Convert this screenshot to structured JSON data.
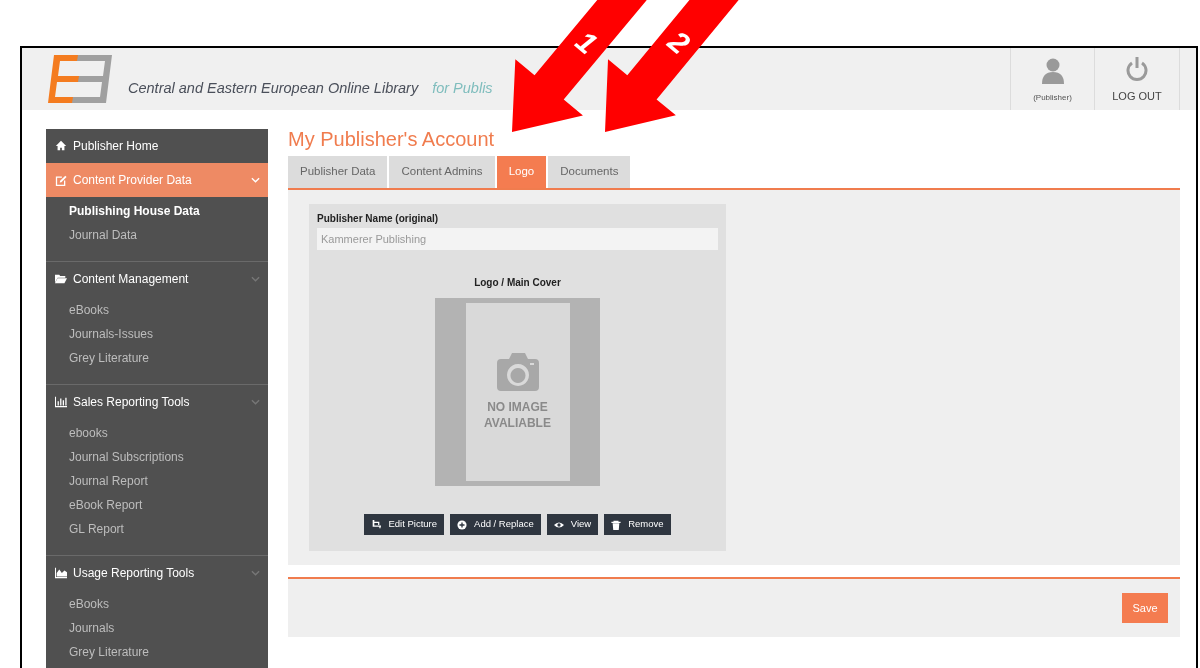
{
  "header": {
    "site_name": "Central and Eastern European Online Library",
    "tagline": "for Publis",
    "user_label": "(Publisher)",
    "logout_label": "LOG OUT"
  },
  "sidebar": {
    "sections": [
      {
        "label": "Publisher Home",
        "kind": "home",
        "selected": false
      },
      {
        "label": "Content Provider Data",
        "kind": "edit",
        "selected": true,
        "items": [
          {
            "label": "Publishing House Data",
            "selected": true
          },
          {
            "label": "Journal Data",
            "selected": false
          }
        ]
      },
      {
        "label": "Content Management",
        "kind": "folder",
        "selected": false,
        "items": [
          {
            "label": "eBooks",
            "selected": false
          },
          {
            "label": "Journals-Issues",
            "selected": false
          },
          {
            "label": "Grey Literature",
            "selected": false
          }
        ]
      },
      {
        "label": "Sales Reporting Tools",
        "kind": "bars",
        "selected": false,
        "items": [
          {
            "label": "ebooks",
            "selected": false
          },
          {
            "label": "Journal Subscriptions",
            "selected": false
          },
          {
            "label": "Journal Report",
            "selected": false
          },
          {
            "label": "eBook Report",
            "selected": false
          },
          {
            "label": "GL Report",
            "selected": false
          }
        ]
      },
      {
        "label": "Usage Reporting Tools",
        "kind": "area",
        "selected": false,
        "items": [
          {
            "label": "eBooks",
            "selected": false
          },
          {
            "label": "Journals",
            "selected": false
          },
          {
            "label": "Grey Literature",
            "selected": false
          }
        ]
      }
    ]
  },
  "page_title": "My Publisher's Account",
  "tabs": [
    {
      "label": "Publisher Data",
      "selected": false
    },
    {
      "label": "Content Admins",
      "selected": false
    },
    {
      "label": "Logo",
      "selected": true
    },
    {
      "label": "Documents",
      "selected": false
    }
  ],
  "form": {
    "name_label": "Publisher Name (original)",
    "name_value": "Kammerer Publishing",
    "logo_label": "Logo / Main Cover",
    "placeholder_lines": [
      "NO IMAGE",
      "AVALIABLE"
    ],
    "buttons": [
      {
        "label": "Edit Picture",
        "kind": "crop"
      },
      {
        "label": "Add / Replace",
        "kind": "plus"
      },
      {
        "label": "View",
        "kind": "eye"
      },
      {
        "label": "Remove",
        "kind": "trash"
      }
    ]
  },
  "save_label": "Save",
  "annotations": [
    {
      "label": "1"
    },
    {
      "label": "2"
    }
  ]
}
